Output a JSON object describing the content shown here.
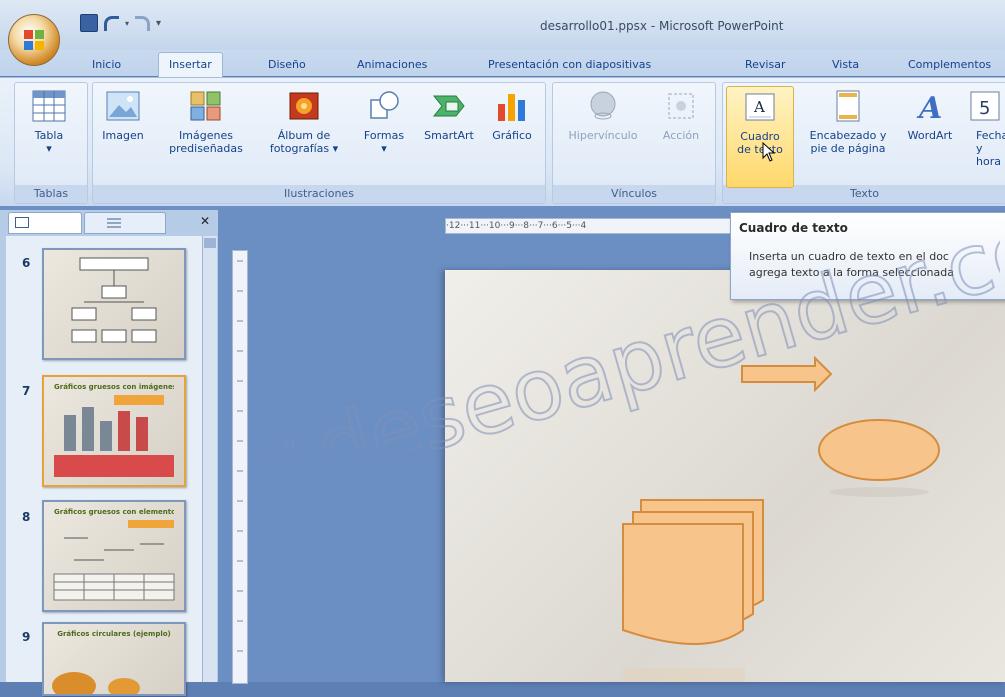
{
  "window": {
    "title": "desarrollo01.ppsx - Microsoft PowerPoint"
  },
  "tabs": [
    "Inicio",
    "Insertar",
    "Diseño",
    "Animaciones",
    "Presentación con diapositivas",
    "Revisar",
    "Vista",
    "Complementos"
  ],
  "active_tab": "Insertar",
  "ribbon": {
    "groups": {
      "tablas": "Tablas",
      "ilustraciones": "Ilustraciones",
      "vinculos": "Vínculos",
      "texto": "Texto"
    },
    "buttons": {
      "tabla": "Tabla",
      "imagen": "Imagen",
      "imagenes_l1": "Imágenes",
      "imagenes_l2": "prediseñadas",
      "album_l1": "Álbum de",
      "album_l2": "fotografías",
      "formas": "Formas",
      "smartart": "SmartArt",
      "grafico": "Gráfico",
      "hipervinculo": "Hipervínculo",
      "accion": "Acción",
      "cuadro_l1": "Cuadro",
      "cuadro_l2": "de texto",
      "encab_l1": "Encabezado y",
      "encab_l2": "pie de página",
      "wordart": "WordArt",
      "fecha_l1": "Fecha",
      "fecha_l2": "y hora"
    }
  },
  "tooltip": {
    "title": "Cuadro de texto",
    "line1": "Inserta un cuadro de texto en el doc",
    "line2": "agrega texto a la forma seleccionada"
  },
  "slides": [
    {
      "num": "6",
      "title": ""
    },
    {
      "num": "7",
      "title": "Gráficos gruesos con imágenes"
    },
    {
      "num": "8",
      "title": "Gráficos gruesos con elementos"
    },
    {
      "num": "9",
      "title": "Gráficos circulares (ejemplo)"
    }
  ],
  "ruler": {
    "h_ticks": "·12···11···10···9···8···7···6···5···4"
  },
  "watermark": "www.deseoaprender.com",
  "colors": {
    "accent_orange": "#f3c48b",
    "shape_stroke": "#d89a45",
    "hover_yellow": "#ffd86b"
  }
}
